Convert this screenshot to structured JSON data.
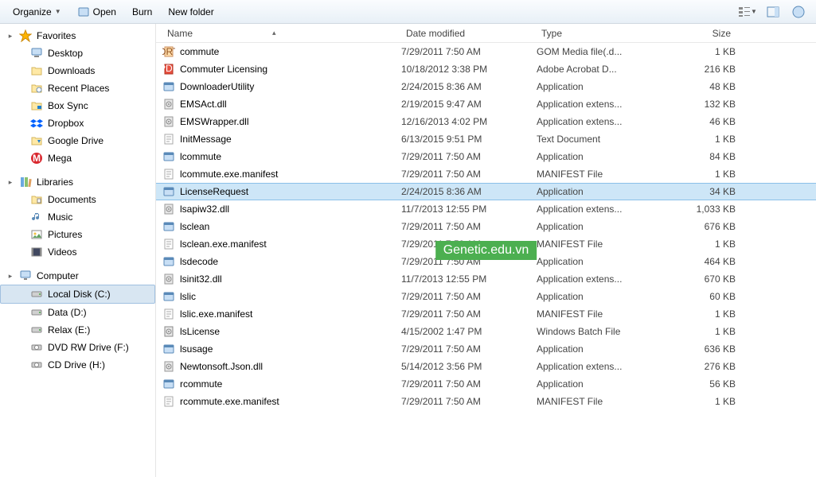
{
  "toolbar": {
    "organize": "Organize",
    "open": "Open",
    "burn": "Burn",
    "newfolder": "New folder"
  },
  "sidebar": {
    "favorites": {
      "label": "Favorites"
    },
    "fav_items": [
      {
        "label": "Desktop",
        "icon": "desktop"
      },
      {
        "label": "Downloads",
        "icon": "folder"
      },
      {
        "label": "Recent Places",
        "icon": "recent"
      },
      {
        "label": "Box Sync",
        "icon": "box"
      },
      {
        "label": "Dropbox",
        "icon": "dropbox"
      },
      {
        "label": "Google Drive",
        "icon": "gdrive"
      },
      {
        "label": "Mega",
        "icon": "mega"
      }
    ],
    "libraries": {
      "label": "Libraries"
    },
    "lib_items": [
      {
        "label": "Documents",
        "icon": "docs"
      },
      {
        "label": "Music",
        "icon": "music"
      },
      {
        "label": "Pictures",
        "icon": "pics"
      },
      {
        "label": "Videos",
        "icon": "videos"
      }
    ],
    "computer": {
      "label": "Computer"
    },
    "comp_items": [
      {
        "label": "Local Disk (C:)",
        "icon": "drive",
        "selected": true
      },
      {
        "label": "Data (D:)",
        "icon": "drive"
      },
      {
        "label": "Relax (E:)",
        "icon": "drive"
      },
      {
        "label": "DVD RW Drive (F:)",
        "icon": "disc"
      },
      {
        "label": "CD Drive (H:)",
        "icon": "disc"
      }
    ]
  },
  "columns": {
    "name": "Name",
    "date": "Date modified",
    "type": "Type",
    "size": "Size"
  },
  "files": [
    {
      "name": "commute",
      "date": "7/29/2011 7:50 AM",
      "type": "GOM Media file(.d...",
      "size": "1 KB",
      "icon": "gom"
    },
    {
      "name": "Commuter Licensing",
      "date": "10/18/2012 3:38 PM",
      "type": "Adobe Acrobat D...",
      "size": "216 KB",
      "icon": "pdf"
    },
    {
      "name": "DownloaderUtility",
      "date": "2/24/2015 8:36 AM",
      "type": "Application",
      "size": "48 KB",
      "icon": "app"
    },
    {
      "name": "EMSAct.dll",
      "date": "2/19/2015 9:47 AM",
      "type": "Application extens...",
      "size": "132 KB",
      "icon": "dll"
    },
    {
      "name": "EMSWrapper.dll",
      "date": "12/16/2013 4:02 PM",
      "type": "Application extens...",
      "size": "46 KB",
      "icon": "dll"
    },
    {
      "name": "InitMessage",
      "date": "6/13/2015 9:51 PM",
      "type": "Text Document",
      "size": "1 KB",
      "icon": "txt"
    },
    {
      "name": "lcommute",
      "date": "7/29/2011 7:50 AM",
      "type": "Application",
      "size": "84 KB",
      "icon": "app"
    },
    {
      "name": "lcommute.exe.manifest",
      "date": "7/29/2011 7:50 AM",
      "type": "MANIFEST File",
      "size": "1 KB",
      "icon": "txt"
    },
    {
      "name": "LicenseRequest",
      "date": "2/24/2015 8:36 AM",
      "type": "Application",
      "size": "34 KB",
      "icon": "app",
      "selected": true
    },
    {
      "name": "lsapiw32.dll",
      "date": "11/7/2013 12:55 PM",
      "type": "Application extens...",
      "size": "1,033 KB",
      "icon": "dll"
    },
    {
      "name": "lsclean",
      "date": "7/29/2011 7:50 AM",
      "type": "Application",
      "size": "676 KB",
      "icon": "app"
    },
    {
      "name": "lsclean.exe.manifest",
      "date": "7/29/2011 7:50 AM",
      "type": "MANIFEST File",
      "size": "1 KB",
      "icon": "txt"
    },
    {
      "name": "lsdecode",
      "date": "7/29/2011 7:50 AM",
      "type": "Application",
      "size": "464 KB",
      "icon": "app"
    },
    {
      "name": "lsinit32.dll",
      "date": "11/7/2013 12:55 PM",
      "type": "Application extens...",
      "size": "670 KB",
      "icon": "dll"
    },
    {
      "name": "lslic",
      "date": "7/29/2011 7:50 AM",
      "type": "Application",
      "size": "60 KB",
      "icon": "app"
    },
    {
      "name": "lslic.exe.manifest",
      "date": "7/29/2011 7:50 AM",
      "type": "MANIFEST File",
      "size": "1 KB",
      "icon": "txt"
    },
    {
      "name": "lsLicense",
      "date": "4/15/2002 1:47 PM",
      "type": "Windows Batch File",
      "size": "1 KB",
      "icon": "bat"
    },
    {
      "name": "lsusage",
      "date": "7/29/2011 7:50 AM",
      "type": "Application",
      "size": "636 KB",
      "icon": "app"
    },
    {
      "name": "Newtonsoft.Json.dll",
      "date": "5/14/2012 3:56 PM",
      "type": "Application extens...",
      "size": "276 KB",
      "icon": "dll"
    },
    {
      "name": "rcommute",
      "date": "7/29/2011 7:50 AM",
      "type": "Application",
      "size": "56 KB",
      "icon": "app"
    },
    {
      "name": "rcommute.exe.manifest",
      "date": "7/29/2011 7:50 AM",
      "type": "MANIFEST File",
      "size": "1 KB",
      "icon": "txt"
    }
  ],
  "watermark": "Genetic.edu.vn"
}
